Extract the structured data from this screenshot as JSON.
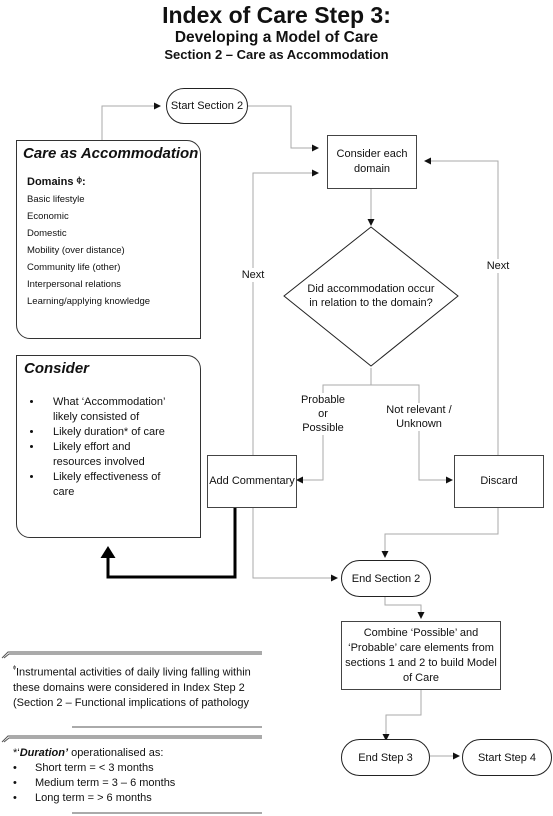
{
  "title": {
    "main": "Index of Care Step 3:",
    "subtitle": "Developing a Model of Care",
    "section": "Section 2  – Care as Accommodation"
  },
  "nodes": {
    "start_section": "Start Section 2",
    "consider_each": "Consider each domain",
    "decision": "Did accommodation occur in relation to the domain?",
    "add_commentary": "Add Commentary",
    "discard": "Discard",
    "end_section": "End Section 2",
    "combine": "Combine ‘Possible’ and ‘Probable’ care elements from sections 1 and 2 to build Model of Care",
    "end_step": "End Step 3",
    "start_step": "Start Step 4"
  },
  "edge_labels": {
    "next_left": "Next",
    "next_right": "Next",
    "probable": "Probable or Possible",
    "not_relevant": "Not relevant / Unknown"
  },
  "care_panel": {
    "heading": "Care as Accommodation",
    "domains_label": "Domains ᶲ:",
    "domains": [
      "Basic lifestyle",
      "Economic",
      "Domestic",
      "Mobility (over distance)",
      "Community life (other)",
      "Interpersonal relations",
      "Learning/applying knowledge"
    ]
  },
  "consider_panel": {
    "heading": "Consider",
    "items": [
      "What ‘Accommodation’ likely consisted of",
      "Likely duration* of care",
      "Likely effort and resources involved",
      "Likely effectiveness of care"
    ]
  },
  "notes": {
    "domains_note_symbol": "ᶲ",
    "domains_note": "Instrumental activities of daily living falling within these domains were considered in Index Step 2 (Section 2 – Functional implications of pathology",
    "duration_prefix": "*‘",
    "duration_term": "Duration’",
    "duration_suffix": " operationalised as:",
    "duration_items": [
      "Short term = < 3 months",
      "Medium term = 3 – 6 months",
      "Long term = > 6 months"
    ]
  }
}
